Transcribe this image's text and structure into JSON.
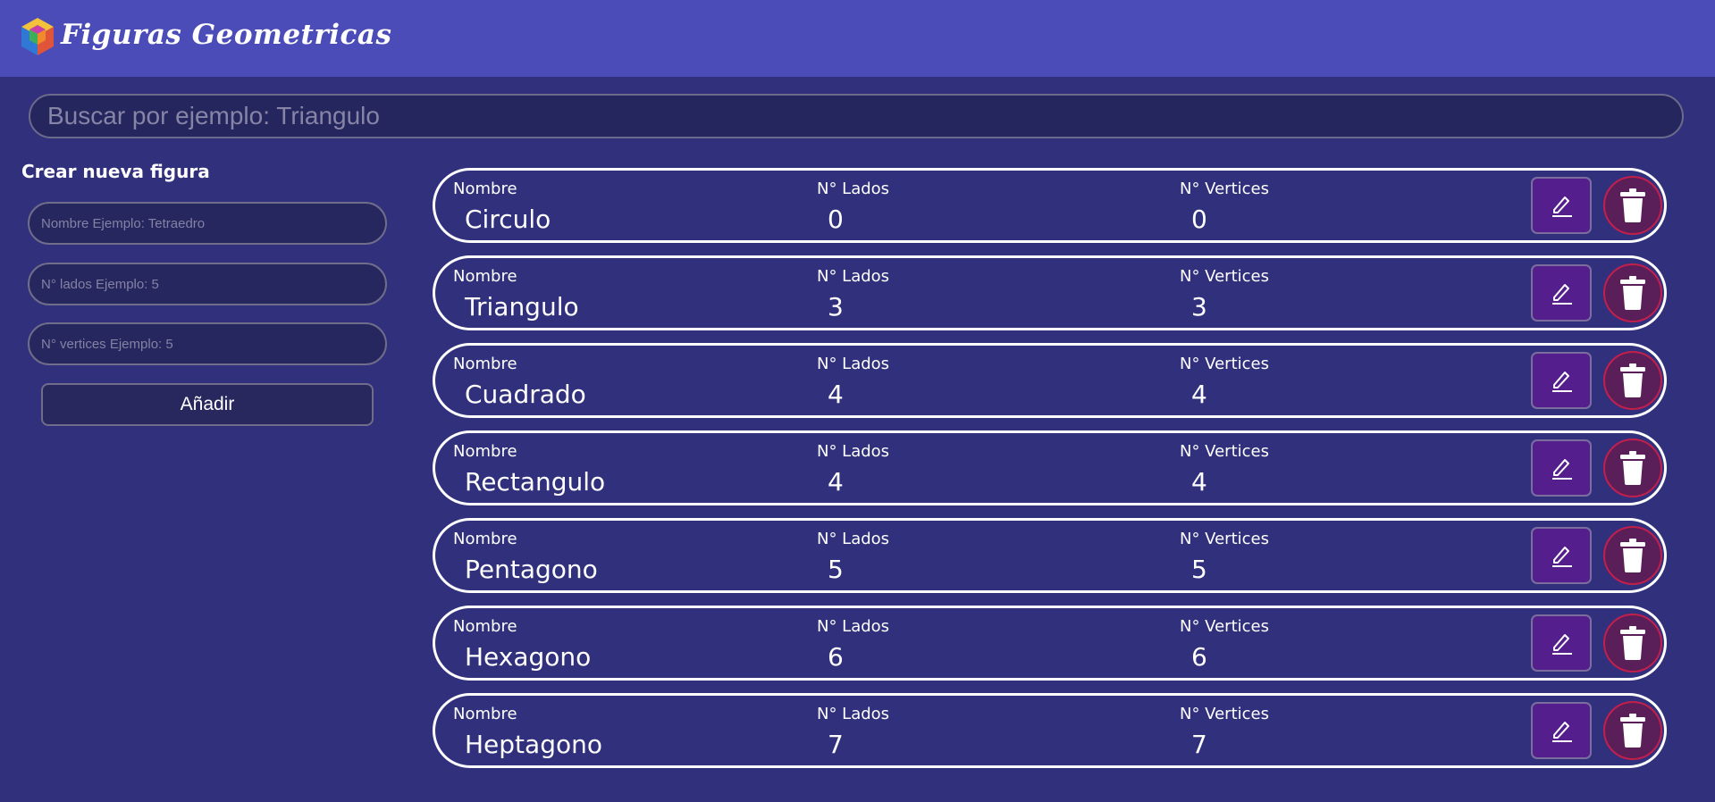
{
  "header": {
    "brand": "Figuras Geometricas"
  },
  "search": {
    "placeholder": "Buscar por ejemplo: Triangulo"
  },
  "create": {
    "title": "Crear nueva figura",
    "name_placeholder": "Nombre Ejemplo: Tetraedro",
    "sides_placeholder": "N° lados Ejemplo: 5",
    "vertices_placeholder": "N° vertices Ejemplo: 5",
    "add_label": "Añadir"
  },
  "labels": {
    "name": "Nombre",
    "sides": "N° Lados",
    "vertices": "N° Vertices"
  },
  "icons": {
    "edit": "pencil-icon",
    "delete": "trash-icon"
  },
  "colors": {
    "background": "#31307c",
    "header": "#4b4cb8",
    "edit_button": "#541f8c",
    "delete_button": "#5a1f58",
    "delete_border": "#c21f4c"
  },
  "figures": [
    {
      "name": "Circulo",
      "sides": "0",
      "vertices": "0"
    },
    {
      "name": "Triangulo",
      "sides": "3",
      "vertices": "3"
    },
    {
      "name": "Cuadrado",
      "sides": "4",
      "vertices": "4"
    },
    {
      "name": "Rectangulo",
      "sides": "4",
      "vertices": "4"
    },
    {
      "name": "Pentagono",
      "sides": "5",
      "vertices": "5"
    },
    {
      "name": "Hexagono",
      "sides": "6",
      "vertices": "6"
    },
    {
      "name": "Heptagono",
      "sides": "7",
      "vertices": "7"
    }
  ]
}
